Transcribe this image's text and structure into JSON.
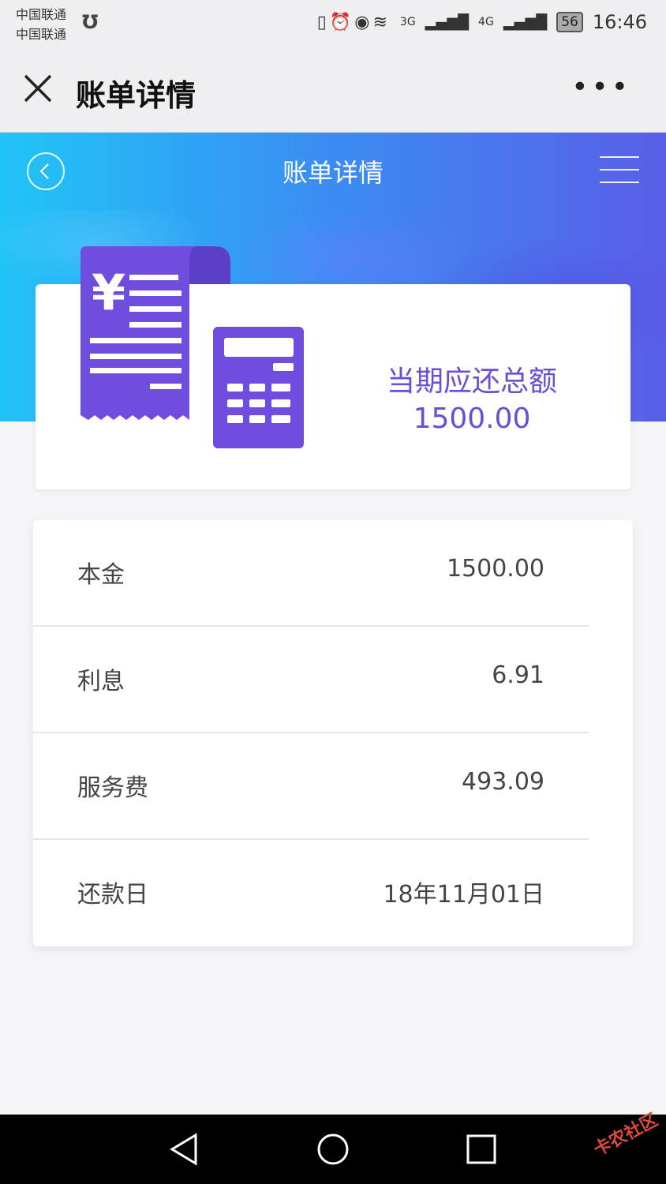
{
  "status_bar": {
    "carrier_1": "中国联通",
    "carrier_2": "中国联通",
    "extra_icon": "Ʊ",
    "network_1": "3G",
    "network_2": "4G",
    "battery": "56",
    "time": "16:46"
  },
  "wechat_nav": {
    "title": "账单详情",
    "more": "•••"
  },
  "header": {
    "title": "账单详情"
  },
  "summary": {
    "label": "当期应还总额",
    "amount": "1500.00"
  },
  "details": [
    {
      "label": "本金",
      "value": "1500.00"
    },
    {
      "label": "利息",
      "value": "6.91"
    },
    {
      "label": "服务费",
      "value": "493.09"
    },
    {
      "label": "还款日",
      "value": "18年11月01日"
    }
  ],
  "watermark": "卡农社区",
  "colors": {
    "accent": "#6a4fd6",
    "gradient_start": "#21c4f7",
    "gradient_end": "#5a5ee8"
  }
}
